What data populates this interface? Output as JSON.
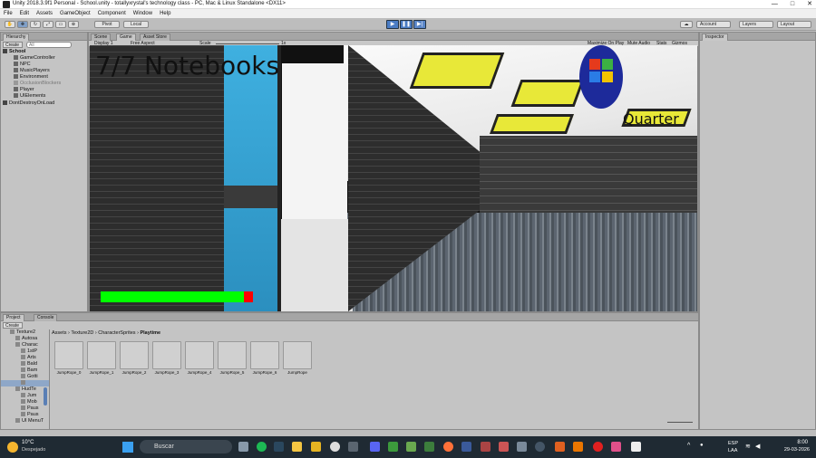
{
  "window": {
    "title": "Unity 2018.3.9f1 Personal - School.unity - totallyxrystal's technology class - PC, Mac & Linux Standalone <DX11>",
    "minimize": "—",
    "maximize": "□",
    "close": "✕"
  },
  "menu": [
    "File",
    "Edit",
    "Assets",
    "GameObject",
    "Component",
    "Window",
    "Help"
  ],
  "toolbar": {
    "pivot": "Pivot",
    "local": "Local",
    "account": "Account",
    "layers": "Layers",
    "layout": "Layout"
  },
  "hierarchy": {
    "tab": "Hierarchy",
    "create": "Create",
    "search_placeholder": "All",
    "scene": "School",
    "items": [
      "GameController",
      "NPC",
      "MusicPlayers",
      "Environment",
      "OcclusionBlockers",
      "Player",
      "UIElements"
    ],
    "dont_destroy": "DontDestroyOnLoad"
  },
  "scene_tabs": {
    "scene": "Scene",
    "game": "Game",
    "asset_store": "Asset Store"
  },
  "game_bar": {
    "display": "Display 1",
    "aspect": "Free Aspect",
    "scale_label": "Scale",
    "scale_value": "1x",
    "maximize_on_play": "Maximize On Play",
    "mute_audio": "Mute Audio",
    "stats": "Stats",
    "gizmos": "Gizmos"
  },
  "hud": {
    "notebooks": "7/7 Notebooks",
    "item": "Quarter",
    "stamina": 0.94
  },
  "inspector": {
    "tab": "Inspector"
  },
  "project": {
    "tab_project": "Project",
    "tab_console": "Console",
    "create": "Create",
    "breadcrumb": [
      "Assets",
      "Texture2D",
      "CharacterSprites",
      "Playtime"
    ],
    "tree": [
      "Texture2",
      "Autosa",
      "Charac",
      "1stP",
      "Arts",
      "Bald",
      "Bam",
      "Gotti",
      "",
      "HudTe",
      "Jum",
      "Mob",
      "Paus",
      "Paus",
      "UI MenuT"
    ],
    "assets": [
      "JumpRope_0",
      "JumpRope_1",
      "JumpRope_2",
      "JumpRope_3",
      "JumpRope_4",
      "JumpRope_5",
      "JumpRope_6",
      "JumpRope"
    ]
  },
  "taskbar": {
    "temp": "10°C",
    "weather": "Despejado",
    "search": "Buscar",
    "lang": "ESP",
    "lang2": "LAA",
    "time": "8:00",
    "date": "29-03-2026"
  },
  "colors": {
    "unity_bg": "#c2c2c2",
    "play_blue": "#4a7cc4",
    "stamina_green": "#00ff00",
    "stamina_red": "#ff0000",
    "taskbar": "#1f2a33"
  }
}
